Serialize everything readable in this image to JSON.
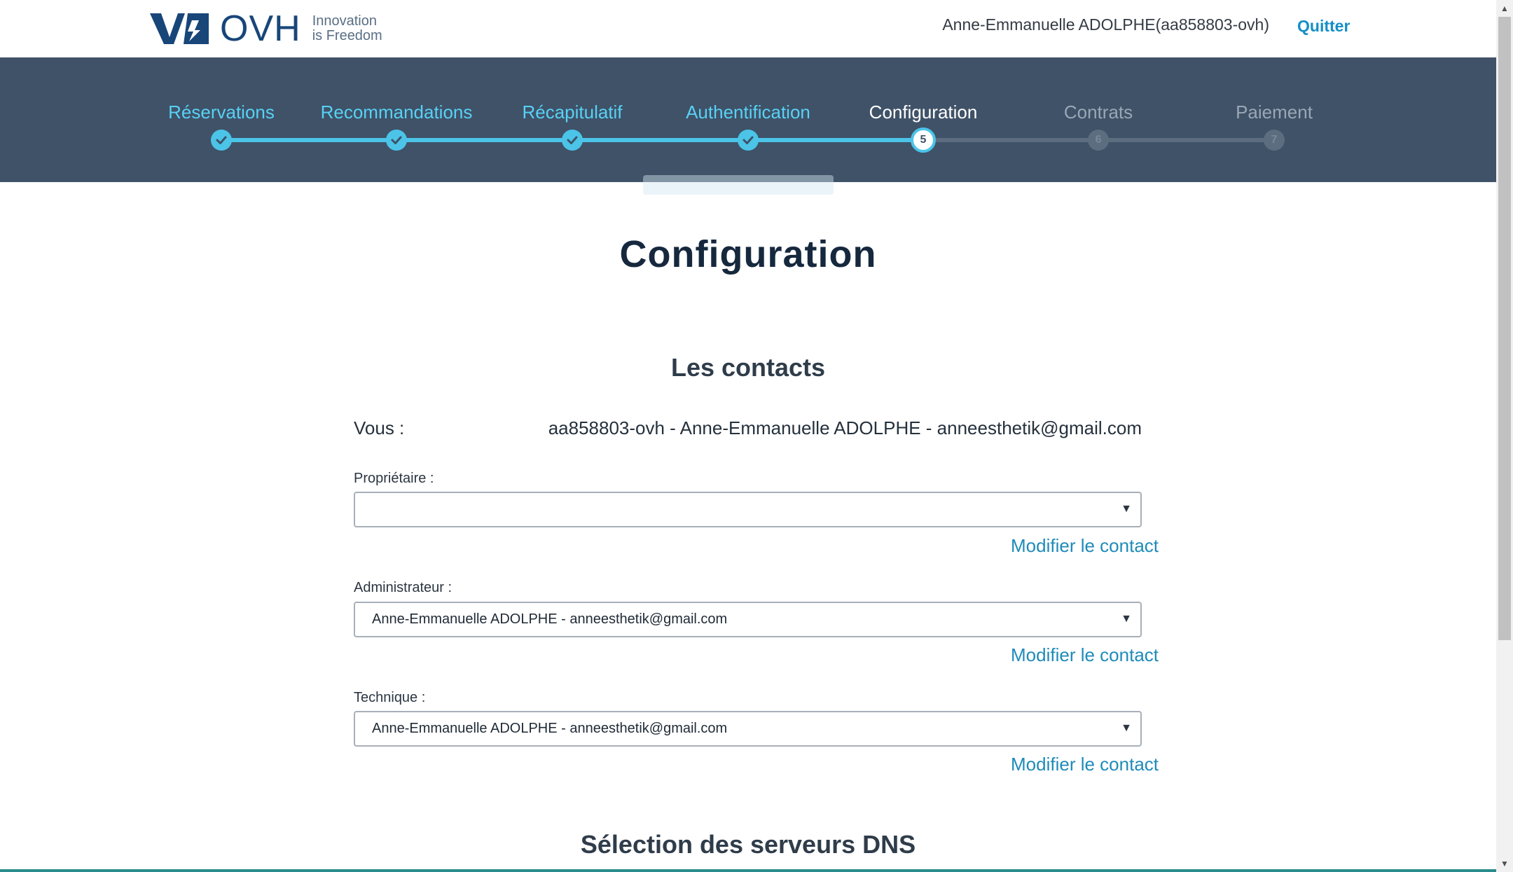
{
  "header": {
    "logo_word": "OVH",
    "logo_tagline_1": "Innovation",
    "logo_tagline_2": "is Freedom",
    "user": "Anne-Emmanuelle ADOLPHE(aa858803-ovh)",
    "quit": "Quitter"
  },
  "steps": [
    {
      "label": "Réservations",
      "state": "done"
    },
    {
      "label": "Recommandations",
      "state": "done"
    },
    {
      "label": "Récapitulatif",
      "state": "done"
    },
    {
      "label": "Authentification",
      "state": "done"
    },
    {
      "label": "Configuration",
      "state": "current",
      "number": "5"
    },
    {
      "label": "Contrats",
      "state": "todo",
      "number": "6"
    },
    {
      "label": "Paiement",
      "state": "todo",
      "number": "7"
    }
  ],
  "colors": {
    "stepper_bg": "#3f5268",
    "step_done": "#4bc4e8",
    "link": "#1f8bb9"
  },
  "main": {
    "title": "Configuration",
    "contacts_title": "Les contacts",
    "vous_label": "Vous :",
    "vous_value": "aa858803-ovh - Anne-Emmanuelle ADOLPHE - anneesthetik@gmail.com",
    "fields": [
      {
        "label": "Propriétaire :",
        "value": "",
        "link": "Modifier le contact"
      },
      {
        "label": "Administrateur :",
        "value": "Anne-Emmanuelle ADOLPHE - anneesthetik@gmail.com",
        "link": "Modifier le contact"
      },
      {
        "label": "Technique :",
        "value": "Anne-Emmanuelle ADOLPHE - anneesthetik@gmail.com",
        "link": "Modifier le contact"
      }
    ],
    "dns_title": "Sélection des serveurs DNS"
  }
}
